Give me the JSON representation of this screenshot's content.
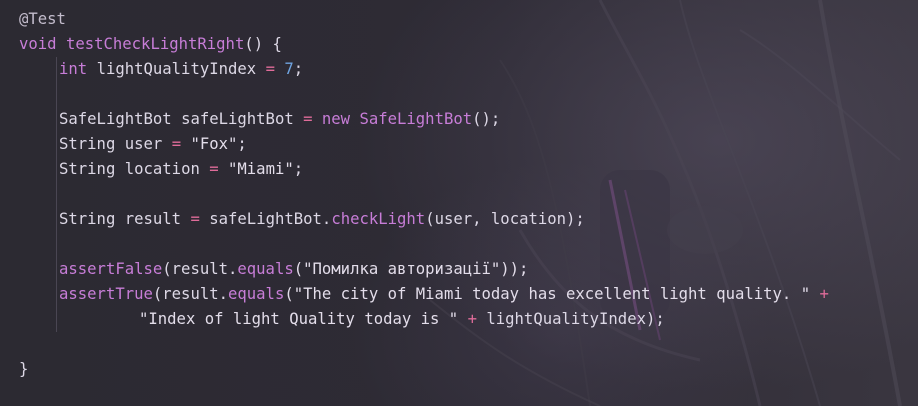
{
  "theme": {
    "background": "#2d2a33",
    "text": "#ddd8e6",
    "keyword": "#c77dd7",
    "number": "#6fa3e0",
    "operator": "#e06c9a"
  },
  "code": {
    "annotation": "@Test",
    "method_decl": {
      "kw_void": "void",
      "name": "testCheckLightRight",
      "tail": "() {"
    },
    "line_index": {
      "kw_int": "int",
      "var": "lightQualityIndex",
      "eq": "=",
      "num": "7",
      "semi": ";"
    },
    "line_bot": {
      "type": "SafeLightBot",
      "var": "safeLightBot",
      "eq": "=",
      "kw_new": "new",
      "ctor": "SafeLightBot",
      "tail": "();"
    },
    "line_user": {
      "type": "String",
      "var": "user",
      "eq": "=",
      "str": "\"Fox\"",
      "semi": ";"
    },
    "line_location": {
      "type": "String",
      "var": "location",
      "eq": "=",
      "str": "\"Miami\"",
      "semi": ";"
    },
    "line_result": {
      "type": "String",
      "var": "result",
      "eq": "=",
      "obj": "safeLightBot.",
      "method": "checkLight",
      "args": "(user, location);"
    },
    "line_assert_false": {
      "fn": "assertFalse",
      "pre": "(result.",
      "method": "equals",
      "str": "(\"Помилка авторизації\"));"
    },
    "line_assert_true": {
      "fn": "assertTrue",
      "pre": "(result.",
      "method": "equals",
      "str": "(\"The city of Miami today has excellent light quality. \"",
      "plus": "+"
    },
    "line_continuation": {
      "str": "\"Index of light Quality today is \"",
      "plus": "+",
      "tail": "lightQualityIndex);"
    },
    "closing_brace": "}"
  }
}
